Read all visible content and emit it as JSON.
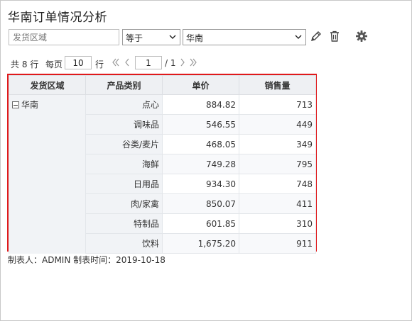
{
  "title": "华南订单情况分析",
  "filter": {
    "field_placeholder": "发货区域",
    "operator": "等于",
    "value": "华南"
  },
  "icons": {
    "edit": "pencil-icon",
    "delete": "trash-icon",
    "settings": "gear-icon"
  },
  "pager": {
    "total_label": "共 8 行",
    "per_page_label": "每页",
    "per_page_value": "10",
    "rows_unit": "行",
    "current_page": "1",
    "total_pages_label": "/ 1"
  },
  "table": {
    "headers": [
      "发货区域",
      "产品类别",
      "单价",
      "销售量"
    ],
    "region": "华南",
    "rows": [
      {
        "category": "点心",
        "price": "884.82",
        "qty": "713"
      },
      {
        "category": "调味品",
        "price": "546.55",
        "qty": "449"
      },
      {
        "category": "谷类/麦片",
        "price": "468.05",
        "qty": "349"
      },
      {
        "category": "海鲜",
        "price": "749.28",
        "qty": "795"
      },
      {
        "category": "日用品",
        "price": "934.30",
        "qty": "748"
      },
      {
        "category": "肉/家禽",
        "price": "850.07",
        "qty": "411"
      },
      {
        "category": "特制品",
        "price": "601.85",
        "qty": "310"
      },
      {
        "category": "饮料",
        "price": "1,675.20",
        "qty": "911"
      }
    ]
  },
  "footer": "制表人：ADMIN  制表时间：2019-10-18",
  "colors": {
    "highlight_border": "#e0191b",
    "header_bg": "#eef0f3"
  }
}
